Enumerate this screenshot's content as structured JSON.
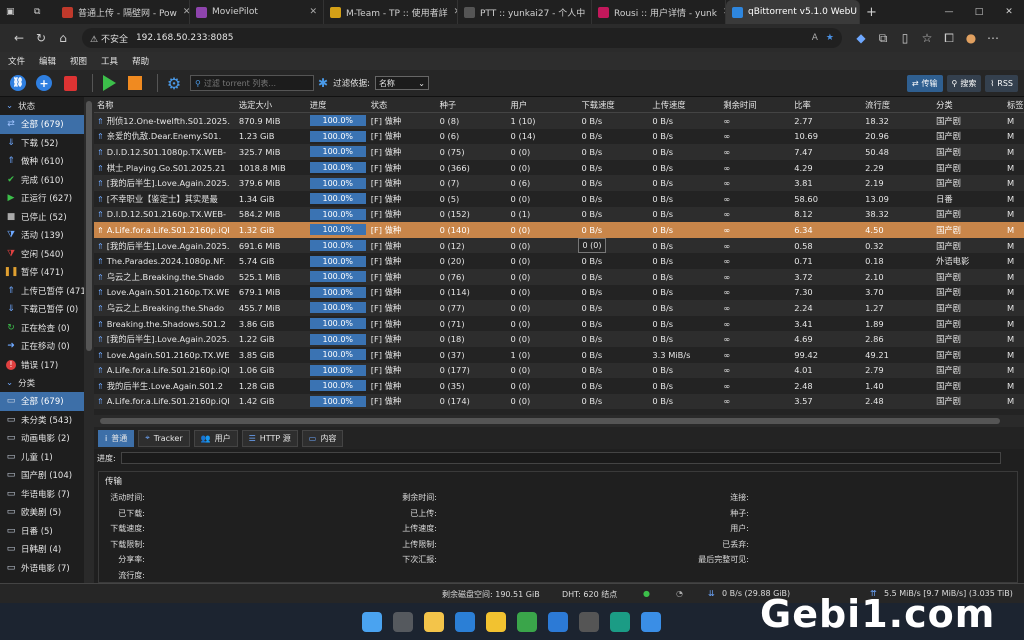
{
  "browser": {
    "tabs": [
      {
        "label": "普通上传 - 隔壁网 - Pow",
        "color": "#c0392b"
      },
      {
        "label": "MoviePilot",
        "color": "#8e44ad"
      },
      {
        "label": "M-Team - TP :: 使用者詳",
        "color": "#d4a017"
      },
      {
        "label": "PTT :: yunkai27 - 个人中",
        "color": "#555555"
      },
      {
        "label": "Rousi :: 用户详情 - yunk",
        "color": "#c2185b"
      },
      {
        "label": "qBittorrent v5.1.0 WebU",
        "color": "#2e86de",
        "active": true
      }
    ],
    "security": "不安全",
    "url": "192.168.50.233:8085"
  },
  "menu": [
    "文件",
    "编辑",
    "视图",
    "工具",
    "帮助"
  ],
  "toolbar": {
    "search_placeholder": "过滤 torrent 列表...",
    "filter_label": "过滤依据:",
    "filter_value": "名称",
    "transfer_btn": "传输",
    "search_btn": "搜索",
    "rss_btn": "RSS"
  },
  "sidebar": {
    "status_header": "状态",
    "status": [
      {
        "label": "全部 (679)",
        "icon": "shuffle-icon",
        "color": "#9fc3ff",
        "selected": true
      },
      {
        "label": "下载 (52)",
        "icon": "download-icon",
        "color": "#6ea8ff"
      },
      {
        "label": "做种 (610)",
        "icon": "upload-icon",
        "color": "#6ea8ff"
      },
      {
        "label": "完成 (610)",
        "icon": "check-icon",
        "color": "#3cbf4a"
      },
      {
        "label": "正运行 (627)",
        "icon": "play-icon",
        "color": "#3cbf4a"
      },
      {
        "label": "已停止 (52)",
        "icon": "stop-icon",
        "color": "#aaaaaa"
      },
      {
        "label": "活动 (139)",
        "icon": "filter-icon",
        "color": "#6ea8ff"
      },
      {
        "label": "空闲 (540)",
        "icon": "filter-red-icon",
        "color": "#e04040"
      },
      {
        "label": "暂停 (471)",
        "icon": "pause-icon",
        "color": "#e0a030"
      },
      {
        "label": "上传已暂停 (471)",
        "icon": "upload-paused-icon",
        "color": "#6ea8ff"
      },
      {
        "label": "下载已暂停 (0)",
        "icon": "download-paused-icon",
        "color": "#6ea8ff"
      },
      {
        "label": "正在检查 (0)",
        "icon": "refresh-icon",
        "color": "#3cbf4a"
      },
      {
        "label": "正在移动 (0)",
        "icon": "move-icon",
        "color": "#6ea8ff"
      },
      {
        "label": "错误 (17)",
        "icon": "error-icon",
        "color": "#e04040"
      }
    ],
    "category_header": "分类",
    "categories": [
      {
        "label": "全部 (679)",
        "selected": true
      },
      {
        "label": "未分类 (543)"
      },
      {
        "label": "动画电影 (2)"
      },
      {
        "label": "儿童 (1)"
      },
      {
        "label": "国产剧 (104)"
      },
      {
        "label": "华语电影 (7)"
      },
      {
        "label": "欧美剧 (5)"
      },
      {
        "label": "日番 (5)"
      },
      {
        "label": "日韩剧 (4)"
      },
      {
        "label": "外语电影 (7)"
      }
    ]
  },
  "table": {
    "headers": [
      "名称",
      "选定大小",
      "进度",
      "状态",
      "种子",
      "用户",
      "下载速度",
      "上传速度",
      "剩余时间",
      "比率",
      "流行度",
      "分类",
      "标签"
    ],
    "rows": [
      {
        "name": "刑侦12.One-twelfth.S01.2025.",
        "size": "870.9 MiB",
        "progress": "100.0%",
        "state": "[F] 做种",
        "seeds": "0 (8)",
        "peers": "1 (10)",
        "dl": "0 B/s",
        "ul": "0 B/s",
        "eta": "∞",
        "ratio": "2.77",
        "pop": "18.32",
        "cat": "国产剧",
        "tag": "M"
      },
      {
        "name": "亲爱的仇敌.Dear.Enemy.S01.",
        "size": "1.23 GiB",
        "progress": "100.0%",
        "state": "[F] 做种",
        "seeds": "0 (6)",
        "peers": "0 (14)",
        "dl": "0 B/s",
        "ul": "0 B/s",
        "eta": "∞",
        "ratio": "10.69",
        "pop": "20.96",
        "cat": "国产剧",
        "tag": "M"
      },
      {
        "name": "D.I.D.12.S01.1080p.TX.WEB-",
        "size": "325.7 MiB",
        "progress": "100.0%",
        "state": "[F] 做种",
        "seeds": "0 (75)",
        "peers": "0 (0)",
        "dl": "0 B/s",
        "ul": "0 B/s",
        "eta": "∞",
        "ratio": "7.47",
        "pop": "50.48",
        "cat": "国产剧",
        "tag": "M"
      },
      {
        "name": "棋士.Playing.Go.S01.2025.21",
        "size": "1018.8 MiB",
        "progress": "100.0%",
        "state": "[F] 做种",
        "seeds": "0 (366)",
        "peers": "0 (0)",
        "dl": "0 B/s",
        "ul": "0 B/s",
        "eta": "∞",
        "ratio": "4.29",
        "pop": "2.29",
        "cat": "国产剧",
        "tag": "M"
      },
      {
        "name": "[我的后半生].Love.Again.2025.",
        "size": "379.6 MiB",
        "progress": "100.0%",
        "state": "[F] 做种",
        "seeds": "0 (7)",
        "peers": "0 (6)",
        "dl": "0 B/s",
        "ul": "0 B/s",
        "eta": "∞",
        "ratio": "3.81",
        "pop": "2.19",
        "cat": "国产剧",
        "tag": "M"
      },
      {
        "name": "[不幸职业【鉴定士】其实是最",
        "size": "1.34 GiB",
        "progress": "100.0%",
        "state": "[F] 做种",
        "seeds": "0 (5)",
        "peers": "0 (0)",
        "dl": "0 B/s",
        "ul": "0 B/s",
        "eta": "∞",
        "ratio": "58.60",
        "pop": "13.09",
        "cat": "日番",
        "tag": "M"
      },
      {
        "name": "D.I.D.12.S01.2160p.TX.WEB-",
        "size": "584.2 MiB",
        "progress": "100.0%",
        "state": "[F] 做种",
        "seeds": "0 (152)",
        "peers": "0 (1)",
        "dl": "0 B/s",
        "ul": "0 B/s",
        "eta": "∞",
        "ratio": "8.12",
        "pop": "38.32",
        "cat": "国产剧",
        "tag": "M"
      },
      {
        "name": "A.Life.for.a.Life.S01.2160p.iQI",
        "size": "1.32 GiB",
        "progress": "100.0%",
        "state": "[F] 做种",
        "seeds": "0 (140)",
        "peers": "0 (0)",
        "dl": "0 B/s",
        "ul": "0 B/s",
        "eta": "∞",
        "ratio": "6.34",
        "pop": "4.50",
        "cat": "国产剧",
        "tag": "M",
        "selected": true
      },
      {
        "name": "[我的后半生].Love.Again.2025.",
        "size": "691.6 MiB",
        "progress": "100.0%",
        "state": "[F] 做种",
        "seeds": "0 (12)",
        "peers": "0 (0)",
        "dl": "0 B/s",
        "ul": "0 B/s",
        "eta": "∞",
        "ratio": "0.58",
        "pop": "0.32",
        "cat": "国产剧",
        "tag": "M"
      },
      {
        "name": "The.Parades.2024.1080p.NF.",
        "size": "5.74 GiB",
        "progress": "100.0%",
        "state": "[F] 做种",
        "seeds": "0 (20)",
        "peers": "0 (0)",
        "dl": "0 B/s",
        "ul": "0 B/s",
        "eta": "∞",
        "ratio": "0.71",
        "pop": "0.18",
        "cat": "外语电影",
        "tag": "M"
      },
      {
        "name": "乌云之上.Breaking.the.Shado",
        "size": "525.1 MiB",
        "progress": "100.0%",
        "state": "[F] 做种",
        "seeds": "0 (76)",
        "peers": "0 (0)",
        "dl": "0 B/s",
        "ul": "0 B/s",
        "eta": "∞",
        "ratio": "3.72",
        "pop": "2.10",
        "cat": "国产剧",
        "tag": "M"
      },
      {
        "name": "Love.Again.S01.2160p.TX.WE",
        "size": "679.1 MiB",
        "progress": "100.0%",
        "state": "[F] 做种",
        "seeds": "0 (114)",
        "peers": "0 (0)",
        "dl": "0 B/s",
        "ul": "0 B/s",
        "eta": "∞",
        "ratio": "7.30",
        "pop": "3.70",
        "cat": "国产剧",
        "tag": "M"
      },
      {
        "name": "乌云之上.Breaking.the.Shado",
        "size": "455.7 MiB",
        "progress": "100.0%",
        "state": "[F] 做种",
        "seeds": "0 (77)",
        "peers": "0 (0)",
        "dl": "0 B/s",
        "ul": "0 B/s",
        "eta": "∞",
        "ratio": "2.24",
        "pop": "1.27",
        "cat": "国产剧",
        "tag": "M"
      },
      {
        "name": "Breaking.the.Shadows.S01.2",
        "size": "3.86 GiB",
        "progress": "100.0%",
        "state": "[F] 做种",
        "seeds": "0 (71)",
        "peers": "0 (0)",
        "dl": "0 B/s",
        "ul": "0 B/s",
        "eta": "∞",
        "ratio": "3.41",
        "pop": "1.89",
        "cat": "国产剧",
        "tag": "M"
      },
      {
        "name": "[我的后半生].Love.Again.2025.",
        "size": "1.22 GiB",
        "progress": "100.0%",
        "state": "[F] 做种",
        "seeds": "0 (18)",
        "peers": "0 (0)",
        "dl": "0 B/s",
        "ul": "0 B/s",
        "eta": "∞",
        "ratio": "4.69",
        "pop": "2.86",
        "cat": "国产剧",
        "tag": "M"
      },
      {
        "name": "Love.Again.S01.2160p.TX.WE",
        "size": "3.85 GiB",
        "progress": "100.0%",
        "state": "[F] 做种",
        "seeds": "0 (37)",
        "peers": "1 (0)",
        "dl": "0 B/s",
        "ul": "3.3 MiB/s",
        "eta": "∞",
        "ratio": "99.42",
        "pop": "49.21",
        "cat": "国产剧",
        "tag": "M"
      },
      {
        "name": "A.Life.for.a.Life.S01.2160p.iQI",
        "size": "1.06 GiB",
        "progress": "100.0%",
        "state": "[F] 做种",
        "seeds": "0 (177)",
        "peers": "0 (0)",
        "dl": "0 B/s",
        "ul": "0 B/s",
        "eta": "∞",
        "ratio": "4.01",
        "pop": "2.79",
        "cat": "国产剧",
        "tag": "M"
      },
      {
        "name": "我的后半生.Love.Again.S01.2",
        "size": "1.28 GiB",
        "progress": "100.0%",
        "state": "[F] 做种",
        "seeds": "0 (35)",
        "peers": "0 (0)",
        "dl": "0 B/s",
        "ul": "0 B/s",
        "eta": "∞",
        "ratio": "2.48",
        "pop": "1.40",
        "cat": "国产剧",
        "tag": "M"
      },
      {
        "name": "A.Life.for.a.Life.S01.2160p.iQI",
        "size": "1.42 GiB",
        "progress": "100.0%",
        "state": "[F] 做种",
        "seeds": "0 (174)",
        "peers": "0 (0)",
        "dl": "0 B/s",
        "ul": "0 B/s",
        "eta": "∞",
        "ratio": "3.57",
        "pop": "2.48",
        "cat": "国产剧",
        "tag": "M"
      }
    ],
    "tooltip": "0 (0)"
  },
  "details": {
    "tabs": [
      "普通",
      "Tracker",
      "用户",
      "HTTP 源",
      "内容"
    ],
    "progress_label": "进度:",
    "section": "传输",
    "fields": {
      "col1": [
        "活动时间:",
        "已下载:",
        "下载速度:",
        "下载限制:",
        "分享率:",
        "流行度:"
      ],
      "col2": [
        "剩余时间:",
        "已上传:",
        "上传速度:",
        "上传限制:",
        "下次汇报:"
      ],
      "col3": [
        "连接:",
        "种子:",
        "用户:",
        "已丢弃:",
        "最后完整可见:"
      ]
    }
  },
  "statusbar": {
    "free_space": "剩余磁盘空间: 190.51 GiB",
    "dht": "DHT: 620 结点",
    "dl_speed": "0 B/s (29.88 GiB)",
    "ul_speed": "5.5 MiB/s [9.7 MiB/s] (3.035 TiB)"
  },
  "watermark": "Gebi1.com"
}
